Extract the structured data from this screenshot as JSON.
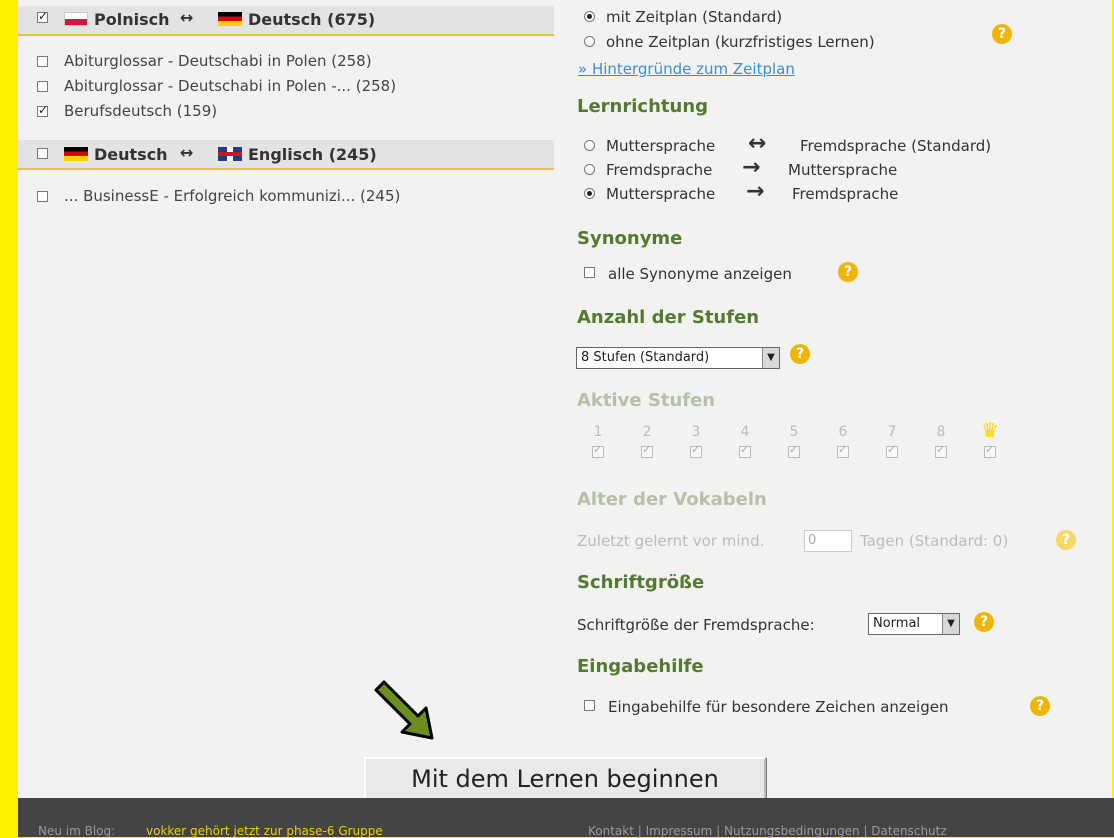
{
  "left": {
    "groups": [
      {
        "label_a": "Polnisch",
        "label_b": "Deutsch (675)",
        "checked": true,
        "items": [
          {
            "label": "Abiturglossar - Deutschabi in Polen (258)",
            "checked": false
          },
          {
            "label": "Abiturglossar - Deutschabi in Polen -... (258)",
            "checked": false
          },
          {
            "label": "Berufsdeutsch (159)",
            "checked": true
          }
        ]
      },
      {
        "label_a": "Deutsch",
        "label_b": "Englisch (245)",
        "checked": false,
        "items": [
          {
            "label": "... BusinessE - Erfolgreich kommunizi... (245)",
            "checked": false
          }
        ]
      }
    ],
    "arrow_symbol": "↔"
  },
  "schedule": {
    "options": [
      "mit Zeitplan (Standard)",
      "ohne Zeitplan (kurzfristiges Lernen)"
    ],
    "selected": 0,
    "link": "» Hintergründe zum Zeitplan"
  },
  "direction": {
    "heading": "Lernrichtung",
    "options": [
      {
        "from": "Muttersprache",
        "arrow": "↔",
        "to": "Fremdsprache (Standard)"
      },
      {
        "from": "Fremdsprache",
        "arrow": "→",
        "to": "Muttersprache"
      },
      {
        "from": "Muttersprache",
        "arrow": "→",
        "to": "Fremdsprache"
      }
    ],
    "selected": 2
  },
  "synonyms": {
    "heading": "Synonyme",
    "label": "alle Synonyme anzeigen",
    "checked": false
  },
  "levels": {
    "heading": "Anzahl der Stufen",
    "value": "8 Stufen (Standard)"
  },
  "active_levels": {
    "heading": "Aktive Stufen",
    "labels": [
      "1",
      "2",
      "3",
      "4",
      "5",
      "6",
      "7",
      "8"
    ],
    "crown": "♛"
  },
  "age": {
    "heading": "Alter der Vokabeln",
    "prefix": "Zuletzt gelernt vor mind.",
    "value": "0",
    "suffix": "Tagen (Standard: 0)"
  },
  "fontsize": {
    "heading": "Schriftgröße",
    "label": "Schriftgröße der Fremdsprache:",
    "value": "Normal"
  },
  "input_help": {
    "heading": "Eingabehilfe",
    "label": "Eingabehilfe für besondere Zeichen anzeigen",
    "checked": false
  },
  "help_symbol": "?",
  "dropdown_symbol": "▼",
  "start_button": "Mit dem Lernen beginnen",
  "footer": {
    "news_prefix": "Neu im Blog:",
    "news_link": "vokker gehört jetzt zur phase-6 Gruppe",
    "links": "Kontakt | Impressum | Nutzungsbedingungen | Datenschutz"
  },
  "colors": {
    "background": "#fff200",
    "panel": "#f2f2f0",
    "heading_green": "#547a31",
    "help_orange": "#f1b500",
    "pointer_arrow": "#6b8e23"
  }
}
